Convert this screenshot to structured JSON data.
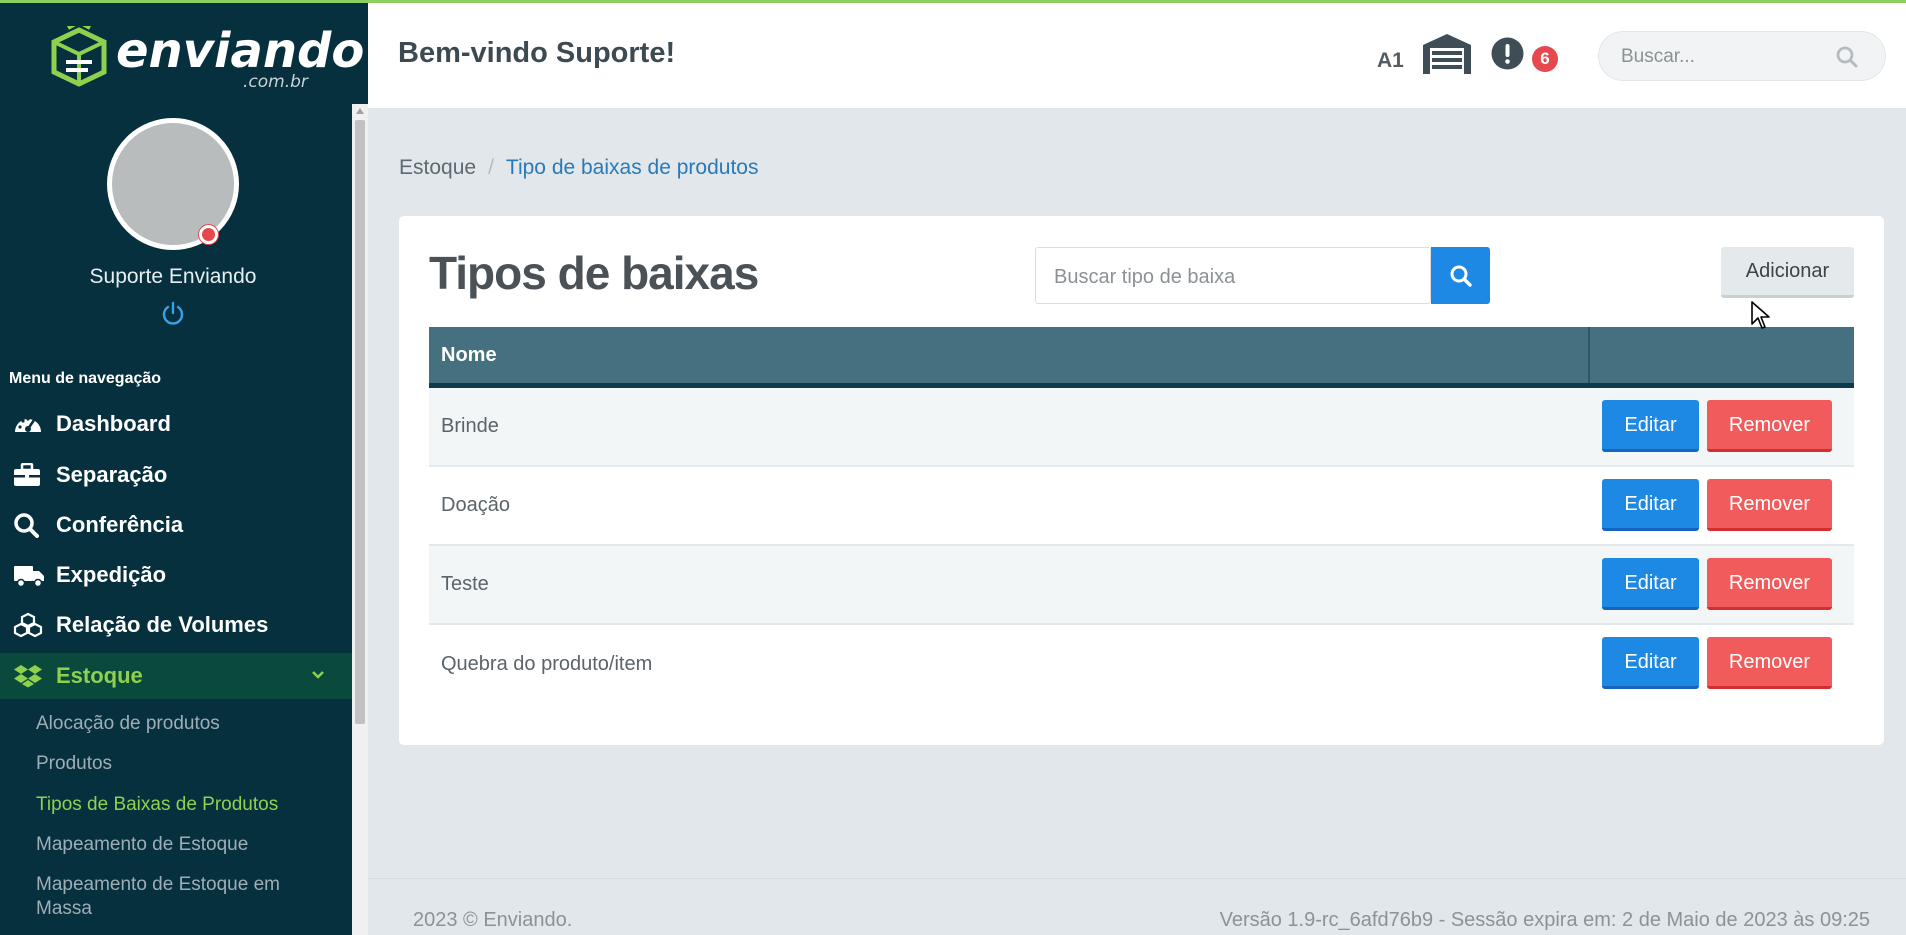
{
  "brand": {
    "name": "enviando",
    "domain": ".com.br",
    "accent": "#8fd14f",
    "sidebar_bg": "#07303f"
  },
  "user": {
    "name": "Suporte Enviando",
    "status": "offline"
  },
  "sidebar": {
    "menu_title": "Menu de navegação",
    "items": [
      {
        "label": "Dashboard",
        "icon": "gauge-icon"
      },
      {
        "label": "Separação",
        "icon": "briefcase-icon"
      },
      {
        "label": "Conferência",
        "icon": "search-icon"
      },
      {
        "label": "Expedição",
        "icon": "truck-icon"
      },
      {
        "label": "Relação de Volumes",
        "icon": "boxes-icon"
      },
      {
        "label": "Estoque",
        "icon": "dropbox-icon",
        "active": true
      }
    ],
    "subitems": [
      {
        "label": "Alocação de produtos"
      },
      {
        "label": "Produtos"
      },
      {
        "label": "Tipos de Baixas de Produtos",
        "active": true
      },
      {
        "label": "Mapeamento de Estoque"
      },
      {
        "label": "Mapeamento de Estoque em Massa"
      }
    ]
  },
  "header": {
    "welcome": "Bem-vindo Suporte!",
    "warehouse_code": "A1",
    "alerts_count": "6",
    "search_placeholder": "Buscar..."
  },
  "breadcrumb": {
    "parent": "Estoque",
    "separator": "/",
    "current": "Tipo de baixas de produtos"
  },
  "main": {
    "title": "Tipos de baixas",
    "search_placeholder": "Buscar tipo de baixa",
    "add_label": "Adicionar",
    "table": {
      "columns": [
        "Nome",
        ""
      ],
      "edit_label": "Editar",
      "remove_label": "Remover",
      "rows": [
        {
          "name": "Brinde"
        },
        {
          "name": "Doação"
        },
        {
          "name": "Teste"
        },
        {
          "name": "Quebra do produto/item"
        }
      ]
    }
  },
  "footer": {
    "copyright": "2023 © Enviando.",
    "version": "Versão 1.9-rc_6afd76b9 - Sessão expira em: 2 de Maio de 2023 às 09:25"
  }
}
